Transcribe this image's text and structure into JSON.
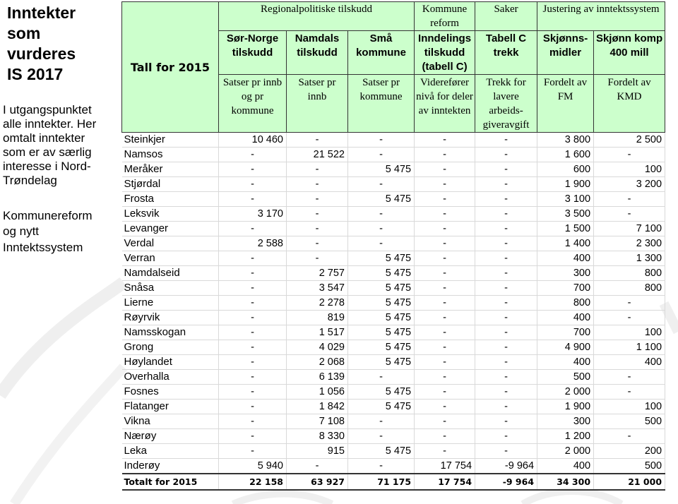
{
  "slide": {
    "title_lines": [
      "Inntekter",
      "som",
      "vurderes",
      "IS 2017"
    ],
    "intro_lines": [
      "I utgangspunktet",
      "alle inntekter. Her",
      "omtalt inntekter",
      "som er av særlig",
      "interesse i Nord-",
      "Trøndelag"
    ],
    "footer_lines": [
      "Kommunereform",
      "og nytt",
      "Inntektssystem"
    ]
  },
  "table": {
    "corner_label": "Tall for 2015",
    "groups": [
      {
        "label": "Regionalpolitiske tilskudd"
      },
      {
        "label": "Kommune reform"
      },
      {
        "label": "Saker"
      },
      {
        "label": "Justering av inntektssystem"
      }
    ],
    "columns": [
      {
        "title": "Sør-Norge tilskudd",
        "desc": "Satser pr innb og pr kommune"
      },
      {
        "title": "Namdals tilskudd",
        "desc": "Satser pr innb"
      },
      {
        "title": "Små kommune",
        "desc": "Satser pr kommune"
      },
      {
        "title": "Inndelings tilskudd (tabell C)",
        "desc": "Viderefører nivå for deler av inntekten"
      },
      {
        "title": "Tabell C trekk",
        "desc": "Trekk for lavere arbeids-giveravgift"
      },
      {
        "title": "Skjønns-midler",
        "desc": "Fordelt av FM"
      },
      {
        "title": "Skjønn komp 400 mill",
        "desc": "Fordelt av KMD"
      }
    ],
    "rows": [
      {
        "name": "Steinkjer",
        "values": [
          "10 460",
          "-",
          "-",
          "-",
          "-",
          "3 800",
          "2 500"
        ]
      },
      {
        "name": "Namsos",
        "values": [
          "-",
          "21 522",
          "-",
          "-",
          "-",
          "1 600",
          "-"
        ]
      },
      {
        "name": "Meråker",
        "values": [
          "-",
          "-",
          "5 475",
          "-",
          "-",
          "600",
          "100"
        ]
      },
      {
        "name": "Stjørdal",
        "values": [
          "-",
          "-",
          "-",
          "-",
          "-",
          "1 900",
          "3 200"
        ]
      },
      {
        "name": "Frosta",
        "values": [
          "-",
          "-",
          "5 475",
          "-",
          "-",
          "3 100",
          "-"
        ]
      },
      {
        "name": "Leksvik",
        "values": [
          "3 170",
          "-",
          "-",
          "-",
          "-",
          "3 500",
          "-"
        ]
      },
      {
        "name": "Levanger",
        "values": [
          "-",
          "-",
          "-",
          "-",
          "-",
          "1 500",
          "7 100"
        ]
      },
      {
        "name": "Verdal",
        "values": [
          "2 588",
          "-",
          "-",
          "-",
          "-",
          "1 400",
          "2 300"
        ]
      },
      {
        "name": "Verran",
        "values": [
          "-",
          "-",
          "5 475",
          "-",
          "-",
          "400",
          "1 300"
        ]
      },
      {
        "name": "Namdalseid",
        "values": [
          "-",
          "2 757",
          "5 475",
          "-",
          "-",
          "300",
          "800"
        ]
      },
      {
        "name": "Snåsa",
        "values": [
          "-",
          "3 547",
          "5 475",
          "-",
          "-",
          "700",
          "800"
        ]
      },
      {
        "name": "Lierne",
        "values": [
          "-",
          "2 278",
          "5 475",
          "-",
          "-",
          "800",
          "-"
        ]
      },
      {
        "name": "Røyrvik",
        "values": [
          "-",
          "819",
          "5 475",
          "-",
          "-",
          "400",
          "-"
        ]
      },
      {
        "name": "Namsskogan",
        "values": [
          "-",
          "1 517",
          "5 475",
          "-",
          "-",
          "700",
          "100"
        ]
      },
      {
        "name": "Grong",
        "values": [
          "-",
          "4 029",
          "5 475",
          "-",
          "-",
          "4 900",
          "1 100"
        ]
      },
      {
        "name": "Høylandet",
        "values": [
          "-",
          "2 068",
          "5 475",
          "-",
          "-",
          "400",
          "400"
        ]
      },
      {
        "name": "Overhalla",
        "values": [
          "-",
          "6 139",
          "-",
          "-",
          "-",
          "500",
          "-"
        ]
      },
      {
        "name": "Fosnes",
        "values": [
          "-",
          "1 056",
          "5 475",
          "-",
          "-",
          "2 000",
          "-"
        ]
      },
      {
        "name": "Flatanger",
        "values": [
          "-",
          "1 842",
          "5 475",
          "-",
          "-",
          "1 900",
          "100"
        ]
      },
      {
        "name": "Vikna",
        "values": [
          "-",
          "7 108",
          "-",
          "-",
          "-",
          "300",
          "500"
        ]
      },
      {
        "name": "Nærøy",
        "values": [
          "-",
          "8 330",
          "-",
          "-",
          "-",
          "1 200",
          "-"
        ]
      },
      {
        "name": "Leka",
        "values": [
          "-",
          "915",
          "5 475",
          "-",
          "-",
          "2 000",
          "200"
        ]
      },
      {
        "name": "Inderøy",
        "values": [
          "5 940",
          "-",
          "-",
          "17 754",
          "-9 964",
          "400",
          "500"
        ]
      }
    ],
    "total": {
      "name": "Totalt for 2015",
      "values": [
        "22 158",
        "63 927",
        "71 175",
        "17 754",
        "-9 964",
        "34 300",
        "21 000"
      ]
    }
  },
  "colors": {
    "header_bg": "#ccffcc",
    "header_border": "#333333",
    "grid": "#d9d9d9"
  }
}
